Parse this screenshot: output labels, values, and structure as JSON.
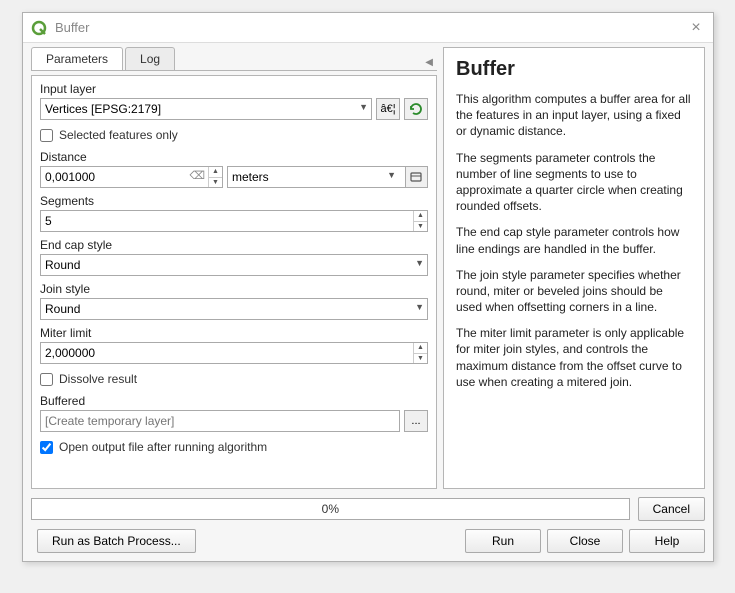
{
  "titlebar": {
    "title": "Buffer"
  },
  "tabs": {
    "parameters": "Parameters",
    "log": "Log"
  },
  "form": {
    "input_layer": {
      "label": "Input layer",
      "value": "Vertices [EPSG:2179]",
      "browse": "â€¦"
    },
    "selected_only": {
      "label": "Selected features only",
      "checked": false
    },
    "distance": {
      "label": "Distance",
      "value": "0,001000",
      "unit": "meters"
    },
    "segments": {
      "label": "Segments",
      "value": "5"
    },
    "end_cap": {
      "label": "End cap style",
      "value": "Round"
    },
    "join_style": {
      "label": "Join style",
      "value": "Round"
    },
    "miter": {
      "label": "Miter limit",
      "value": "2,000000"
    },
    "dissolve": {
      "label": "Dissolve result",
      "checked": false
    },
    "buffered": {
      "label": "Buffered",
      "placeholder": "[Create temporary layer]",
      "browse": "..."
    },
    "open_output": {
      "label": "Open output file after running algorithm",
      "checked": true
    }
  },
  "help": {
    "title": "Buffer",
    "p1": "This algorithm computes a buffer area for all the features in an input layer, using a fixed or dynamic distance.",
    "p2": "The segments parameter controls the number of line segments to use to approximate a quarter circle when creating rounded offsets.",
    "p3": "The end cap style parameter controls how line endings are handled in the buffer.",
    "p4": "The join style parameter specifies whether round, miter or beveled joins should be used when offsetting corners in a line.",
    "p5": "The miter limit parameter is only applicable for miter join styles, and controls the maximum distance from the offset curve to use when creating a mitered join."
  },
  "progress": {
    "text": "0%"
  },
  "buttons": {
    "cancel": "Cancel",
    "batch": "Run as Batch Process...",
    "run": "Run",
    "close": "Close",
    "help_btn": "Help"
  }
}
